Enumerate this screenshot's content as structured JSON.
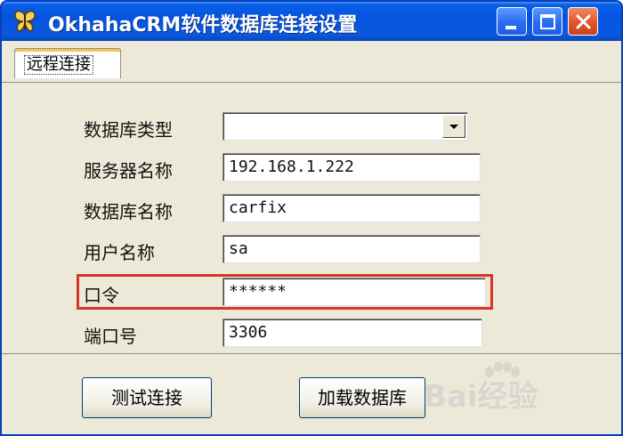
{
  "window": {
    "title": "OkhahaCRM软件数据库连接设置",
    "icons": {
      "app": "butterfly-app-icon",
      "minimize": "minimize-icon",
      "maximize": "maximize-icon",
      "close": "close-icon"
    }
  },
  "tabs": [
    {
      "label": "远程连接",
      "selected": true
    }
  ],
  "form": {
    "db_type": {
      "label": "数据库类型",
      "value": ""
    },
    "server_name": {
      "label": "服务器名称",
      "value": "192.168.1.222"
    },
    "db_name": {
      "label": "数据库名称",
      "value": "carfix"
    },
    "username": {
      "label": "用户名称",
      "value": "sa"
    },
    "password": {
      "label": "口令",
      "value": "******"
    },
    "port": {
      "label": "端口号",
      "value": "3306"
    }
  },
  "buttons": {
    "test": "测试连接",
    "load": "加载数据库"
  },
  "watermark": {
    "text": "Bai经验"
  },
  "colors": {
    "titlebar": "#0454e0",
    "highlight": "#d8342c",
    "panel": "#ece9d8"
  }
}
